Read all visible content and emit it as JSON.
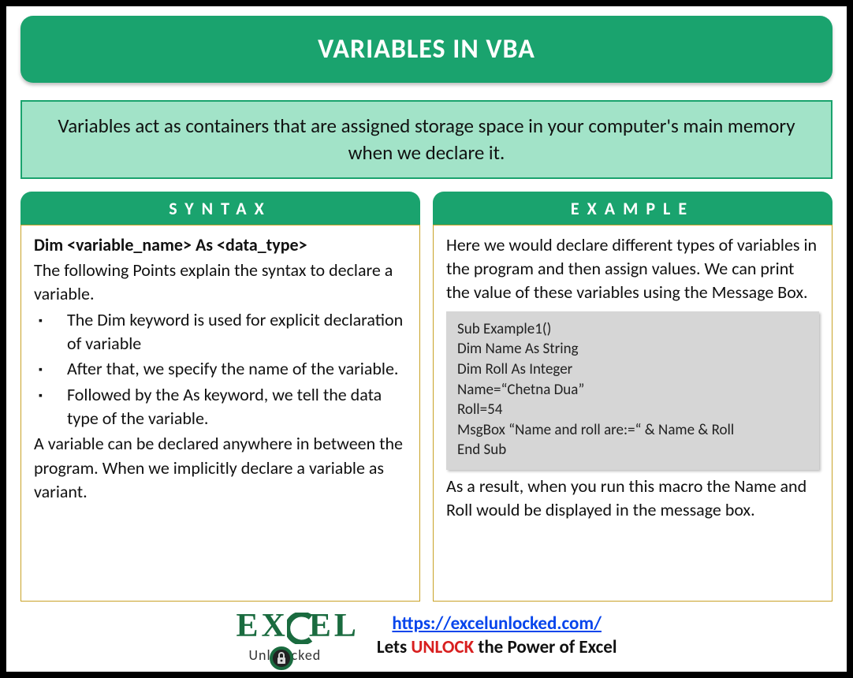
{
  "title": "VARIABLES IN VBA",
  "subtitle": "Variables act as containers that are assigned storage space in your computer's main memory when we declare it.",
  "syntax": {
    "header": "SYNTAX",
    "declaration": "Dim <variable_name> As <data_type>",
    "intro": "The following Points explain the syntax to declare a variable.",
    "points": [
      "The Dim keyword is used for explicit declaration of variable",
      "After that, we specify the name of the variable.",
      "Followed by the As keyword, we tell the data type of the variable."
    ],
    "outro": "A variable can be declared anywhere in between the program. When we implicitly declare a variable as variant."
  },
  "example": {
    "header": "EXAMPLE",
    "intro": "Here we would declare different types of variables in the program and then assign values. We can print the value of these variables using the Message Box.",
    "code": [
      "Sub Example1()",
      "Dim Name As String",
      "Dim Roll As Integer",
      "Name=“Chetna Dua”",
      "Roll=54",
      "MsgBox “Name and roll are:=“ & Name & Roll",
      "End Sub"
    ],
    "outro": "As a result, when you run this macro the Name and Roll would be displayed in the message box."
  },
  "footer": {
    "logo_top": "EXCEL",
    "logo_bottom_pre": "Unl",
    "logo_bottom_post": "cked",
    "url": "https://excelunlocked.com/",
    "tag_pre": "Lets ",
    "tag_unlock": "UNLOCK",
    "tag_post": " the Power of Excel"
  }
}
